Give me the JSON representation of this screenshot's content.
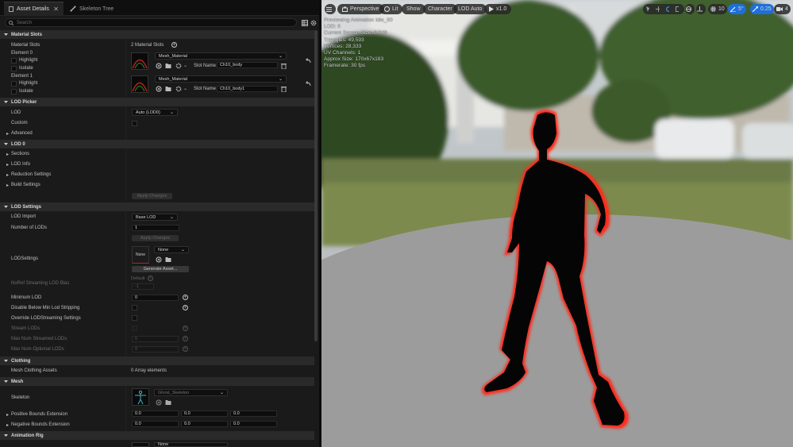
{
  "tabs": [
    {
      "label": "Asset Details"
    },
    {
      "label": "Skeleton Tree"
    }
  ],
  "search": {
    "placeholder": "Search"
  },
  "sections": {
    "material_slots": "Material Slots",
    "lod_picker": "LOD Picker",
    "lod0": "LOD 0",
    "lod_settings": "LOD Settings",
    "clothing": "Clothing",
    "mesh": "Mesh",
    "animation_rig": "Animation Rig"
  },
  "material_slots": {
    "label": "Material Slots",
    "count_text": "2 Material Slots",
    "elements": [
      {
        "name": "Element 0",
        "highlight": "Highlight",
        "isolate": "Isolate",
        "material": "Mesh_Material",
        "slot_label": "Slot Name",
        "slot_name": "Ch10_body"
      },
      {
        "name": "Element 1",
        "highlight": "Highlight",
        "isolate": "Isolate",
        "material": "Mesh_Material",
        "slot_label": "Slot Name",
        "slot_name": "Ch10_body1"
      }
    ]
  },
  "lod_picker": {
    "lod_label": "LOD",
    "lod_value": "Auto (LOD0)",
    "custom_label": "Custom",
    "advanced_label": "Advanced"
  },
  "lod0": {
    "sections": "Sections",
    "lod_info": "LOD Info",
    "reduction": "Reduction Settings",
    "build": "Build Settings",
    "apply": "Apply Changes"
  },
  "lod_settings": {
    "lod_import_label": "LOD Import",
    "lod_import_value": "Base LOD",
    "num_lods_label": "Number of LODs",
    "num_lods_value": "1",
    "apply": "Apply Changes",
    "lodsettings_label": "LODSettings",
    "thumb_text": "None",
    "lodsettings_value": "None",
    "generate": "Generate Asset...",
    "noref_label": "NoRef Streaming LOD Bias",
    "noref_default": "Default",
    "noref_value": "-1",
    "min_lod_label": "Minimum LOD",
    "min_lod_value": "0",
    "disable_below_label": "Disable Below Min Lod Stripping",
    "override_label": "Override LODStreaming Settings",
    "stream_lods_label": "Stream LODs",
    "max_streamed_label": "Max Num Streamed LODs",
    "max_streamed_value": "0",
    "max_optional_label": "Max Num Optional LODs",
    "max_optional_value": "0"
  },
  "clothing": {
    "label": "Mesh Clothing Assets",
    "value": "0 Array elements"
  },
  "mesh": {
    "skeleton_label": "Skeleton",
    "skeleton_value": "Ghost_Skeleton",
    "pos_bounds_label": "Positive Bounds Extension",
    "pos_bounds": [
      "0.0",
      "0.0",
      "0.0"
    ],
    "neg_bounds_label": "Negative Bounds Extension",
    "neg_bounds": [
      "0.0",
      "0.0",
      "0.0"
    ]
  },
  "anim_rig": {
    "value": "None"
  },
  "viewport": {
    "perspective": "Perspective",
    "lit": "Lit",
    "show": "Show",
    "character": "Character",
    "lod_auto": "LOD Auto",
    "play_speed": "x1.0",
    "grid_value": "10",
    "angle_value": "5°",
    "scale_value": "0.25",
    "camera_value": "4",
    "stats": [
      "Previewing Animation Idle_00",
      "LOD: 0",
      "Current Screen Size: 0.849",
      "Triangles: 49,593",
      "Vertices: 28,333",
      "UV Channels: 1",
      "Approx Size: 170x67x183",
      "Framerate: 30 fps"
    ]
  },
  "colors": {
    "accent": "#1e6fd9",
    "outline": "#ff2a1a"
  }
}
